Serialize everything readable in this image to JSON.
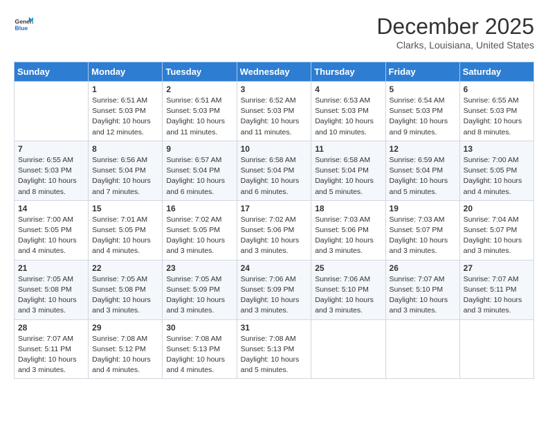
{
  "header": {
    "logo_general": "General",
    "logo_blue": "Blue",
    "month_title": "December 2025",
    "location": "Clarks, Louisiana, United States"
  },
  "days_of_week": [
    "Sunday",
    "Monday",
    "Tuesday",
    "Wednesday",
    "Thursday",
    "Friday",
    "Saturday"
  ],
  "weeks": [
    [
      {
        "day": "",
        "info": ""
      },
      {
        "day": "1",
        "info": "Sunrise: 6:51 AM\nSunset: 5:03 PM\nDaylight: 10 hours\nand 12 minutes."
      },
      {
        "day": "2",
        "info": "Sunrise: 6:51 AM\nSunset: 5:03 PM\nDaylight: 10 hours\nand 11 minutes."
      },
      {
        "day": "3",
        "info": "Sunrise: 6:52 AM\nSunset: 5:03 PM\nDaylight: 10 hours\nand 11 minutes."
      },
      {
        "day": "4",
        "info": "Sunrise: 6:53 AM\nSunset: 5:03 PM\nDaylight: 10 hours\nand 10 minutes."
      },
      {
        "day": "5",
        "info": "Sunrise: 6:54 AM\nSunset: 5:03 PM\nDaylight: 10 hours\nand 9 minutes."
      },
      {
        "day": "6",
        "info": "Sunrise: 6:55 AM\nSunset: 5:03 PM\nDaylight: 10 hours\nand 8 minutes."
      }
    ],
    [
      {
        "day": "7",
        "info": "Sunrise: 6:55 AM\nSunset: 5:03 PM\nDaylight: 10 hours\nand 8 minutes."
      },
      {
        "day": "8",
        "info": "Sunrise: 6:56 AM\nSunset: 5:04 PM\nDaylight: 10 hours\nand 7 minutes."
      },
      {
        "day": "9",
        "info": "Sunrise: 6:57 AM\nSunset: 5:04 PM\nDaylight: 10 hours\nand 6 minutes."
      },
      {
        "day": "10",
        "info": "Sunrise: 6:58 AM\nSunset: 5:04 PM\nDaylight: 10 hours\nand 6 minutes."
      },
      {
        "day": "11",
        "info": "Sunrise: 6:58 AM\nSunset: 5:04 PM\nDaylight: 10 hours\nand 5 minutes."
      },
      {
        "day": "12",
        "info": "Sunrise: 6:59 AM\nSunset: 5:04 PM\nDaylight: 10 hours\nand 5 minutes."
      },
      {
        "day": "13",
        "info": "Sunrise: 7:00 AM\nSunset: 5:05 PM\nDaylight: 10 hours\nand 4 minutes."
      }
    ],
    [
      {
        "day": "14",
        "info": "Sunrise: 7:00 AM\nSunset: 5:05 PM\nDaylight: 10 hours\nand 4 minutes."
      },
      {
        "day": "15",
        "info": "Sunrise: 7:01 AM\nSunset: 5:05 PM\nDaylight: 10 hours\nand 4 minutes."
      },
      {
        "day": "16",
        "info": "Sunrise: 7:02 AM\nSunset: 5:05 PM\nDaylight: 10 hours\nand 3 minutes."
      },
      {
        "day": "17",
        "info": "Sunrise: 7:02 AM\nSunset: 5:06 PM\nDaylight: 10 hours\nand 3 minutes."
      },
      {
        "day": "18",
        "info": "Sunrise: 7:03 AM\nSunset: 5:06 PM\nDaylight: 10 hours\nand 3 minutes."
      },
      {
        "day": "19",
        "info": "Sunrise: 7:03 AM\nSunset: 5:07 PM\nDaylight: 10 hours\nand 3 minutes."
      },
      {
        "day": "20",
        "info": "Sunrise: 7:04 AM\nSunset: 5:07 PM\nDaylight: 10 hours\nand 3 minutes."
      }
    ],
    [
      {
        "day": "21",
        "info": "Sunrise: 7:05 AM\nSunset: 5:08 PM\nDaylight: 10 hours\nand 3 minutes."
      },
      {
        "day": "22",
        "info": "Sunrise: 7:05 AM\nSunset: 5:08 PM\nDaylight: 10 hours\nand 3 minutes."
      },
      {
        "day": "23",
        "info": "Sunrise: 7:05 AM\nSunset: 5:09 PM\nDaylight: 10 hours\nand 3 minutes."
      },
      {
        "day": "24",
        "info": "Sunrise: 7:06 AM\nSunset: 5:09 PM\nDaylight: 10 hours\nand 3 minutes."
      },
      {
        "day": "25",
        "info": "Sunrise: 7:06 AM\nSunset: 5:10 PM\nDaylight: 10 hours\nand 3 minutes."
      },
      {
        "day": "26",
        "info": "Sunrise: 7:07 AM\nSunset: 5:10 PM\nDaylight: 10 hours\nand 3 minutes."
      },
      {
        "day": "27",
        "info": "Sunrise: 7:07 AM\nSunset: 5:11 PM\nDaylight: 10 hours\nand 3 minutes."
      }
    ],
    [
      {
        "day": "28",
        "info": "Sunrise: 7:07 AM\nSunset: 5:11 PM\nDaylight: 10 hours\nand 3 minutes."
      },
      {
        "day": "29",
        "info": "Sunrise: 7:08 AM\nSunset: 5:12 PM\nDaylight: 10 hours\nand 4 minutes."
      },
      {
        "day": "30",
        "info": "Sunrise: 7:08 AM\nSunset: 5:13 PM\nDaylight: 10 hours\nand 4 minutes."
      },
      {
        "day": "31",
        "info": "Sunrise: 7:08 AM\nSunset: 5:13 PM\nDaylight: 10 hours\nand 5 minutes."
      },
      {
        "day": "",
        "info": ""
      },
      {
        "day": "",
        "info": ""
      },
      {
        "day": "",
        "info": ""
      }
    ]
  ]
}
